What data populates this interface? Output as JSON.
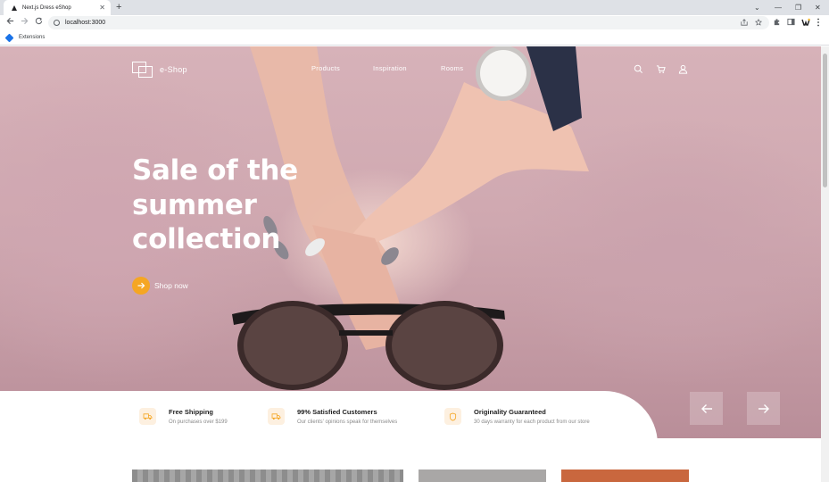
{
  "browser": {
    "tab_title": "Next.js Dress eShop",
    "tab_close": "✕",
    "new_tab": "+",
    "url": "localhost:3000",
    "bookmark_label": "Extensions",
    "window_controls": [
      "⌄",
      "—",
      "❐",
      "✕"
    ]
  },
  "site": {
    "logo_text": "e-Shop",
    "nav": [
      "Products",
      "Inspiration",
      "Rooms"
    ]
  },
  "hero": {
    "headline_lines": [
      "Sale of the",
      "summer",
      "collection"
    ],
    "cta_label": "Shop now"
  },
  "features": [
    {
      "title": "Free Shipping",
      "subtitle": "On purchases over $199"
    },
    {
      "title": "99% Satisfied Customers",
      "subtitle": "Our clients' opinions speak for themselves"
    },
    {
      "title": "Originality Guaranteed",
      "subtitle": "30 days warranty for each product from our store"
    }
  ],
  "colors": {
    "accent": "#f5a623",
    "feature_icon_bg": "#fdf0e0",
    "hero_pink": "#d7b2b9"
  }
}
